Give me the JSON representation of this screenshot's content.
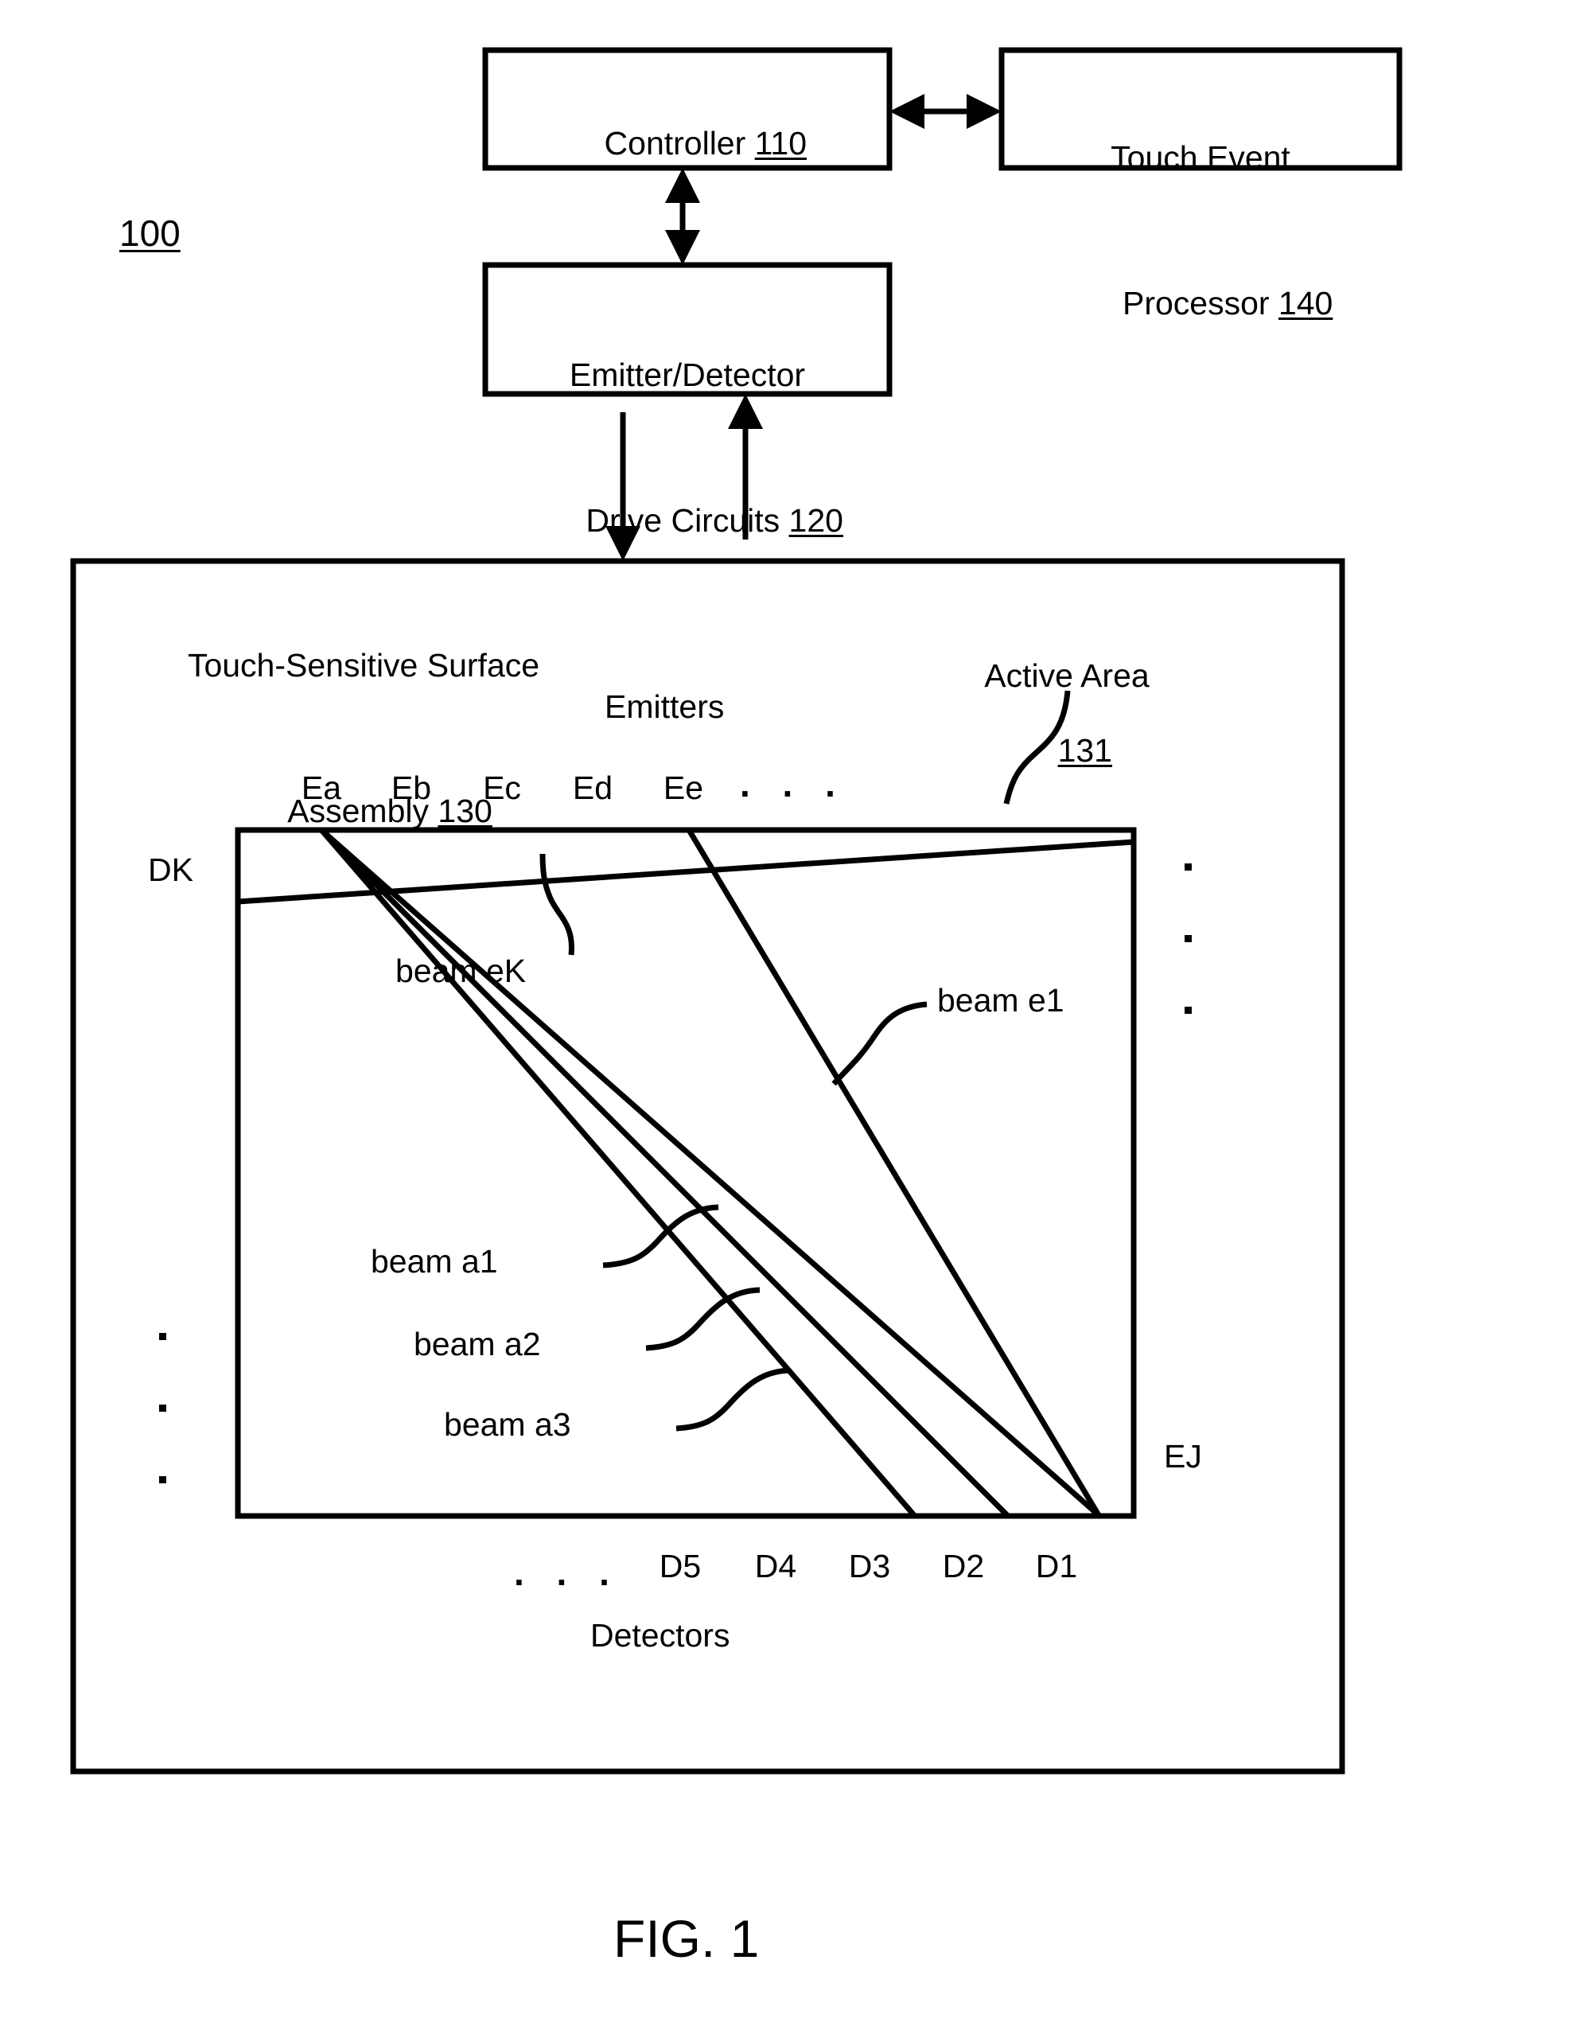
{
  "figure": {
    "caption": "FIG. 1",
    "system_ref": "100"
  },
  "blocks": {
    "controller": {
      "label": "Controller",
      "ref": "110"
    },
    "touch_event_processor": {
      "line1": "Touch Event",
      "line2": "Processor",
      "ref": "140"
    },
    "drive_circuits": {
      "line1": "Emitter/Detector",
      "line2": "Drive Circuits",
      "ref": "120"
    }
  },
  "assembly": {
    "title_line1": "Touch-Sensitive Surface",
    "title_line2": "Assembly",
    "ref": "130",
    "active_area": {
      "label": "Active Area",
      "ref": "131"
    }
  },
  "axes": {
    "emitters_title": "Emitters",
    "detectors_title": "Detectors",
    "emitter_labels": [
      "Ea",
      "Eb",
      "Ec",
      "Ed",
      "Ee"
    ],
    "emitter_ellipsis": ". . .",
    "detector_labels": [
      "D5",
      "D4",
      "D3",
      "D2",
      "D1"
    ],
    "detector_ellipsis": ". . .",
    "last_detector": "DK",
    "last_emitter": "EJ"
  },
  "beams": {
    "ek": "beam eK",
    "e1": "beam e1",
    "a1": "beam a1",
    "a2": "beam a2",
    "a3": "beam a3"
  }
}
